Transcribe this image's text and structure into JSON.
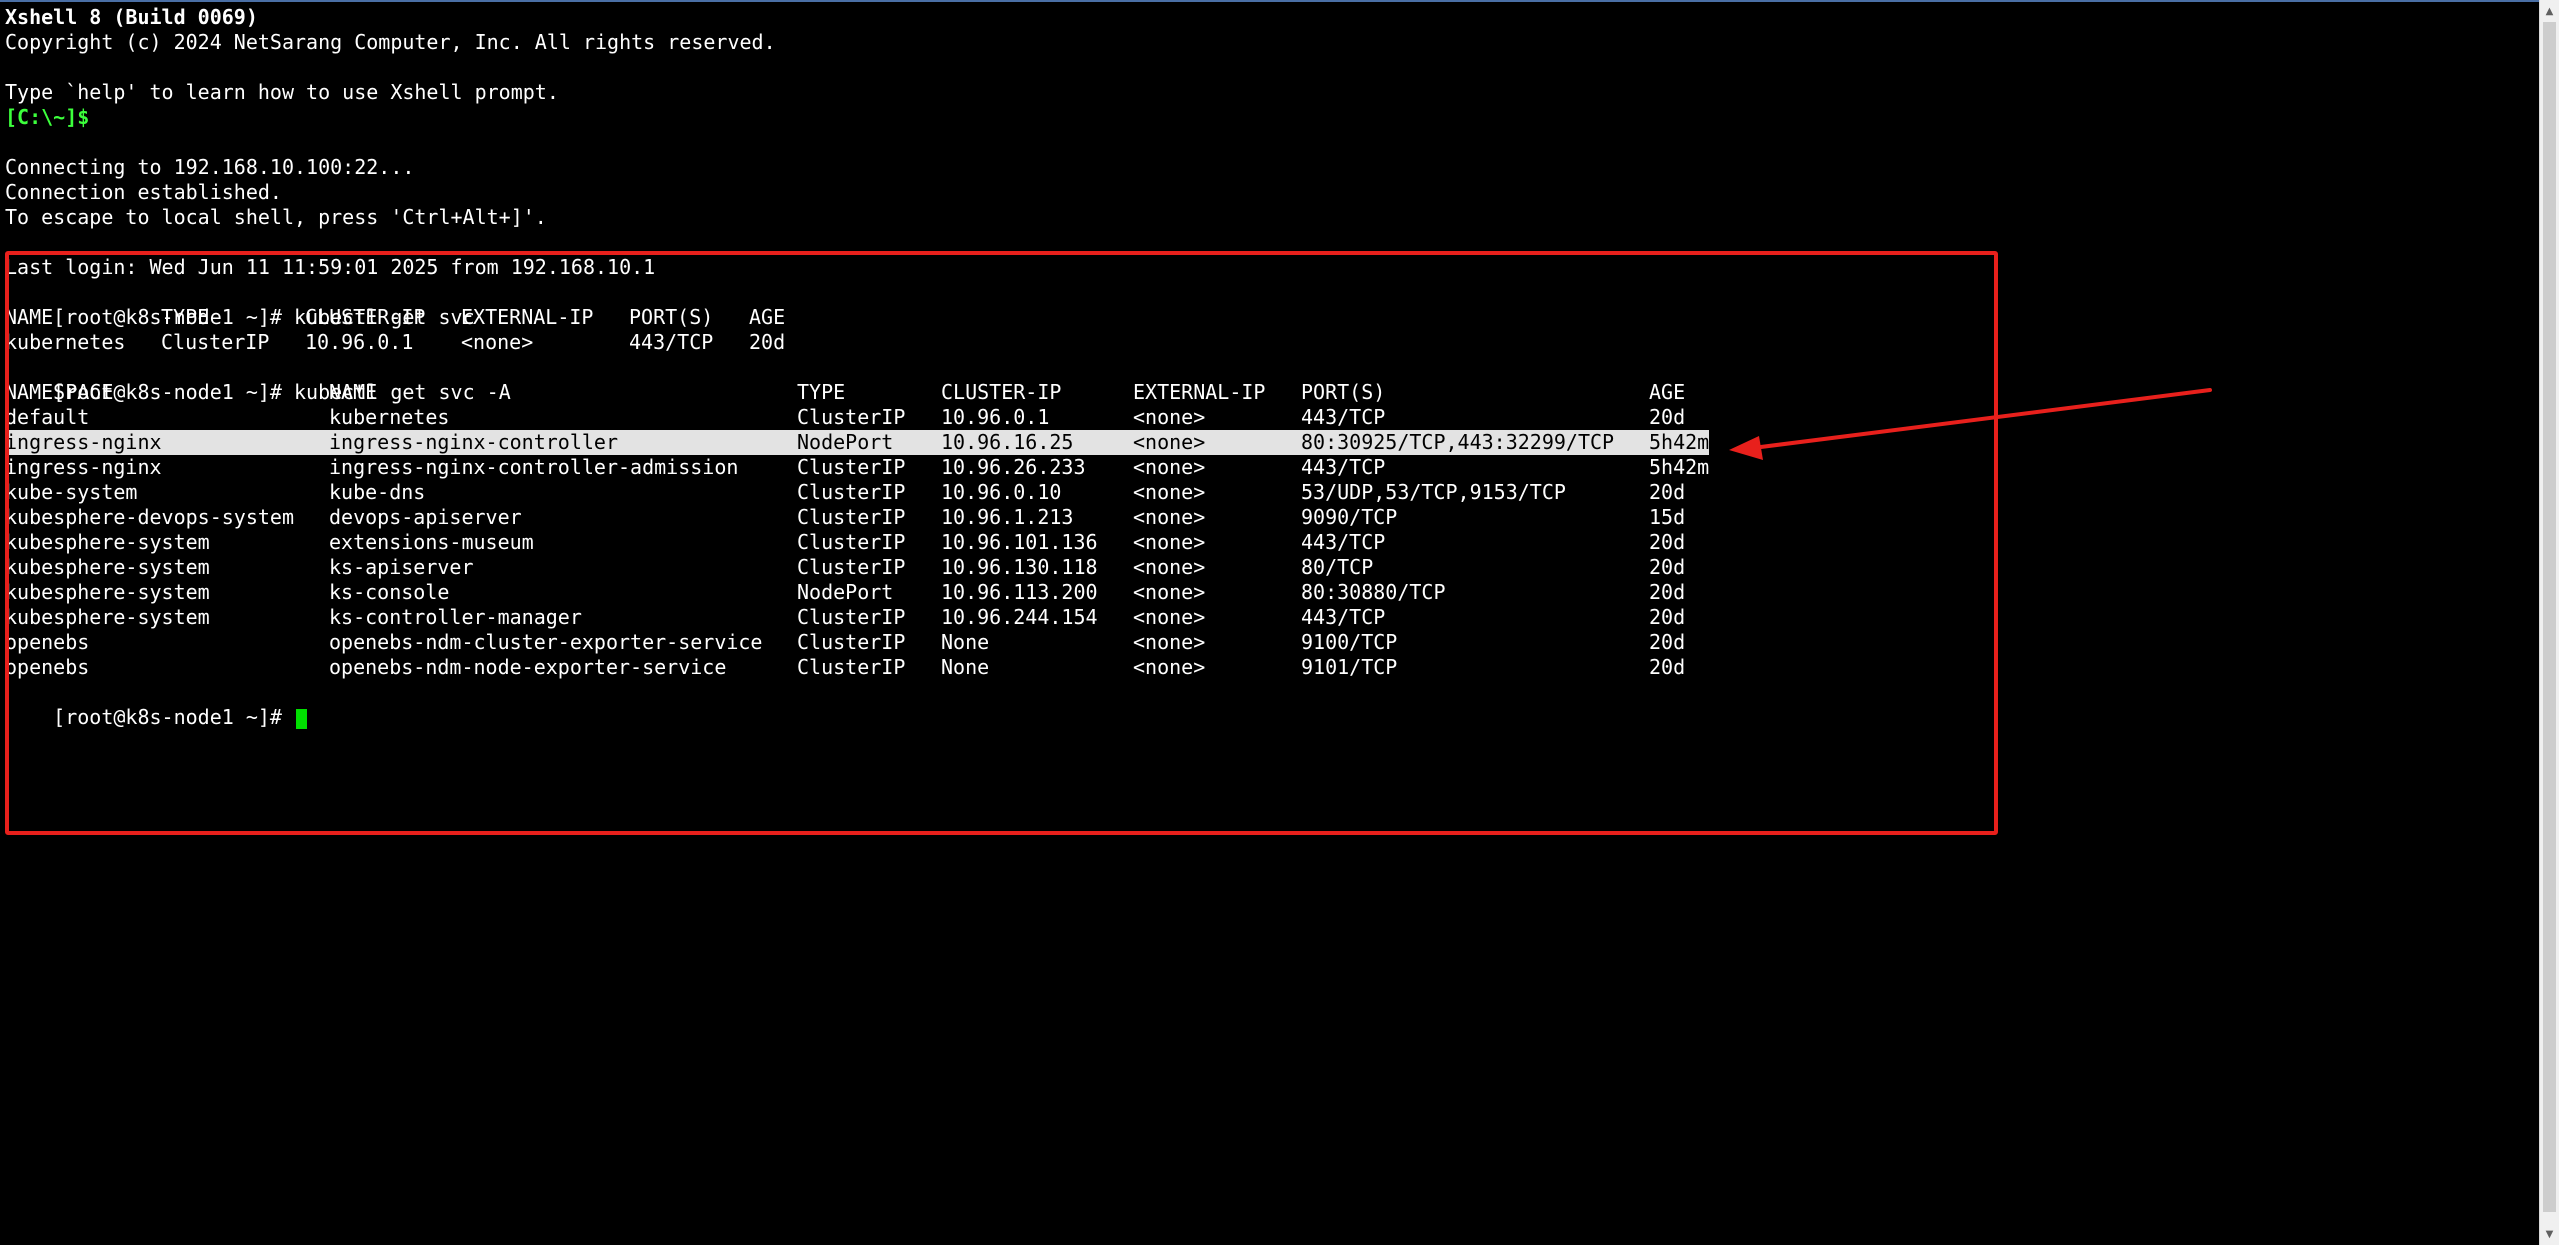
{
  "header": {
    "title": "Xshell 8 (Build 0069)",
    "copyright": "Copyright (c) 2024 NetSarang Computer, Inc. All rights reserved.",
    "help_hint": "Type `help' to learn how to use Xshell prompt.",
    "local_prompt": "[C:\\~]$"
  },
  "connection": {
    "connecting": "Connecting to 192.168.10.100:22...",
    "established": "Connection established.",
    "escape_hint": "To escape to local shell, press 'Ctrl+Alt+]'."
  },
  "session": {
    "last_login": "Last login: Wed Jun 11 11:59:01 2025 from 192.168.10.1",
    "prompt": "[root@k8s-node1 ~]# ",
    "cmd1": "kubectl get svc",
    "cmd2": "kubectl get svc -A",
    "final_prompt": "[root@k8s-node1 ~]# "
  },
  "svc_table": {
    "headers": [
      "NAME",
      "TYPE",
      "CLUSTER-IP",
      "EXTERNAL-IP",
      "PORT(S)",
      "AGE"
    ],
    "rows": [
      [
        "kubernetes",
        "ClusterIP",
        "10.96.0.1",
        "<none>",
        "443/TCP",
        "20d"
      ]
    ]
  },
  "svc_all_table": {
    "headers": [
      "NAMESPACE",
      "NAME",
      "TYPE",
      "CLUSTER-IP",
      "EXTERNAL-IP",
      "PORT(S)",
      "AGE"
    ],
    "rows": [
      [
        "default",
        "kubernetes",
        "ClusterIP",
        "10.96.0.1",
        "<none>",
        "443/TCP",
        "20d"
      ],
      [
        "ingress-nginx",
        "ingress-nginx-controller",
        "NodePort",
        "10.96.16.25",
        "<none>",
        "80:30925/TCP,443:32299/TCP",
        "5h42m"
      ],
      [
        "ingress-nginx",
        "ingress-nginx-controller-admission",
        "ClusterIP",
        "10.96.26.233",
        "<none>",
        "443/TCP",
        "5h42m"
      ],
      [
        "kube-system",
        "kube-dns",
        "ClusterIP",
        "10.96.0.10",
        "<none>",
        "53/UDP,53/TCP,9153/TCP",
        "20d"
      ],
      [
        "kubesphere-devops-system",
        "devops-apiserver",
        "ClusterIP",
        "10.96.1.213",
        "<none>",
        "9090/TCP",
        "15d"
      ],
      [
        "kubesphere-system",
        "extensions-museum",
        "ClusterIP",
        "10.96.101.136",
        "<none>",
        "443/TCP",
        "20d"
      ],
      [
        "kubesphere-system",
        "ks-apiserver",
        "ClusterIP",
        "10.96.130.118",
        "<none>",
        "80/TCP",
        "20d"
      ],
      [
        "kubesphere-system",
        "ks-console",
        "NodePort",
        "10.96.113.200",
        "<none>",
        "80:30880/TCP",
        "20d"
      ],
      [
        "kubesphere-system",
        "ks-controller-manager",
        "ClusterIP",
        "10.96.244.154",
        "<none>",
        "443/TCP",
        "20d"
      ],
      [
        "openebs",
        "openebs-ndm-cluster-exporter-service",
        "ClusterIP",
        "None",
        "<none>",
        "9100/TCP",
        "20d"
      ],
      [
        "openebs",
        "openebs-ndm-node-exporter-service",
        "ClusterIP",
        "None",
        "<none>",
        "9101/TCP",
        "20d"
      ]
    ]
  },
  "colors": {
    "annotation_red": "#e8201c",
    "prompt_green": "#3cff3c",
    "highlight_row": "#e3e3e3",
    "cursor_green": "#00e000"
  }
}
